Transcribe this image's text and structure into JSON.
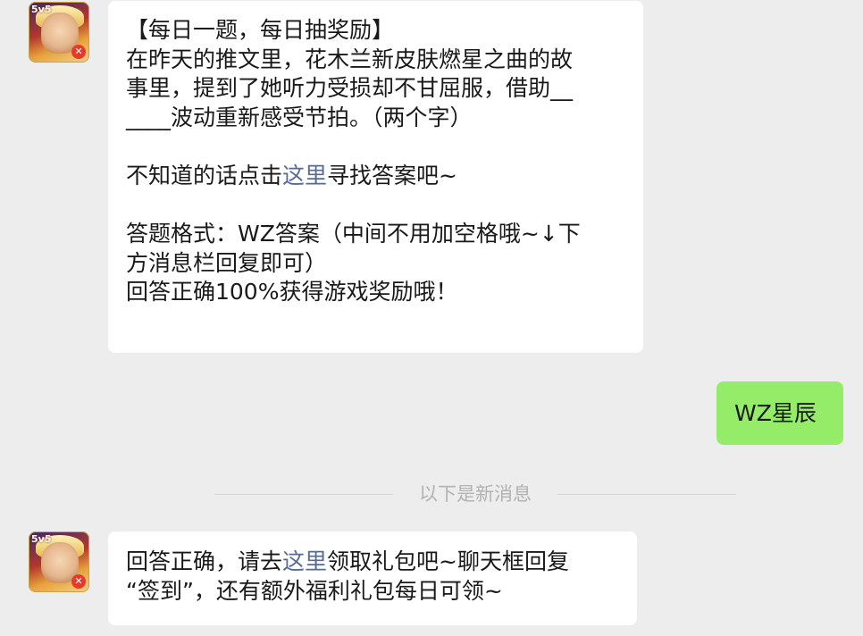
{
  "messages": [
    {
      "sender": "game-official",
      "avatar": {
        "logo": "5v5",
        "badge": "✕"
      },
      "lines": [
        "【每日一题，每日抽奖励】",
        "在昨天的推文里，花木兰新皮肤燃星之曲的故",
        "事里，提到了她听力受损却不甘屈服，借助__",
        "____波动重新感受节拍。（两个字）",
        "",
        [
          "不知道的话点击",
          "这里",
          "寻找答案吧~"
        ],
        "",
        "答题格式：WZ答案（中间不用加空格哦~↓下",
        "方消息栏回复即可）",
        "回答正确100%获得游戏奖励哦！"
      ]
    },
    {
      "sender": "me",
      "text": "WZ星辰"
    },
    {
      "sender": "game-official",
      "avatar": {
        "logo": "5v5",
        "badge": "✕"
      },
      "lines": [
        [
          "回答正确，请去",
          "这里",
          "领取礼包吧~聊天框回复"
        ],
        "“签到”，还有额外福利礼包每日可领~"
      ]
    }
  ],
  "divider": {
    "label": "以下是新消息"
  },
  "colors": {
    "background": "#ededed",
    "bubble_received": "#ffffff",
    "bubble_sent": "#95ec69",
    "link": "#576b95",
    "divider_text": "#b2b2b2"
  }
}
